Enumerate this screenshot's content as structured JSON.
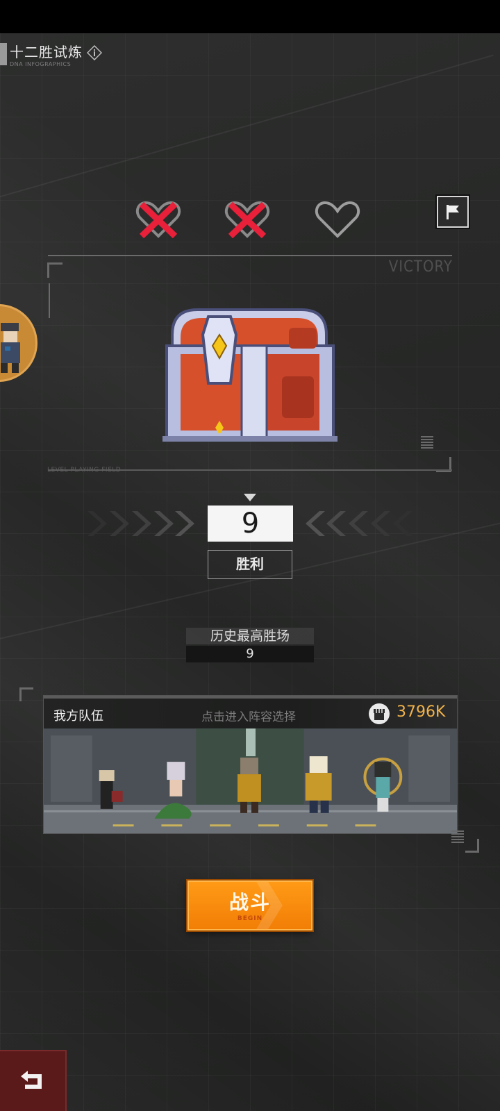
{
  "header": {
    "title": "十二胜试炼",
    "subtitle": "DNA INFOGRAPHICS"
  },
  "lives": {
    "lost": 2,
    "remaining": 1,
    "total": 3
  },
  "panel": {
    "victory_text": "VICTORY",
    "field_text": "LEVEL PLAYING FIELD"
  },
  "counter": {
    "wins": "9",
    "result_label": "胜利"
  },
  "best": {
    "label": "历史最高胜场",
    "value": "9"
  },
  "team": {
    "label": "我方队伍",
    "hint": "点击进入阵容选择",
    "power": "3796K"
  },
  "fight_button": {
    "label": "战斗",
    "sub_label": "BEGIN"
  },
  "colors": {
    "accent_orange": "#f7890c",
    "power_gold": "#f1b24a",
    "lost_red": "#e8203a",
    "background": "#262726"
  },
  "icons": {
    "info": "info-icon",
    "flag": "flag-icon",
    "back": "back-arrow-icon",
    "power": "fist-icon",
    "chest": "treasure-chest-icon"
  }
}
